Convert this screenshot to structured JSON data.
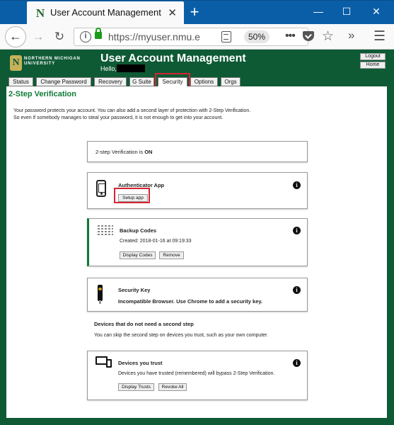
{
  "browser": {
    "tab_title": "User Account Management",
    "url": "https://myuser.nmu.e",
    "zoom": "50%",
    "colors": {
      "titlebar": "#0a5ea8",
      "toolbar": "#f9f9fa"
    }
  },
  "header": {
    "logo_text_line1": "NORTHERN MICHIGAN",
    "logo_text_line2": "UNIVERSITY",
    "title": "User Account Management",
    "hello": "Hello,",
    "logout": "Logout",
    "home": "Home",
    "colors": {
      "brand_green": "#0e5a35",
      "gold": "#c6b25a"
    }
  },
  "tabs": [
    "Status",
    "Change Password",
    "Recovery",
    "G Suite",
    "Security",
    "Options",
    "Orgs"
  ],
  "active_tab": "Security",
  "section_title": "2-Step Verification",
  "intro_line1": "Your password protects your account. You can also add a second layer of protection with 2-Step Verification.",
  "intro_line2": "So even if somebody manages to steal your password, it is not enough to get into your account.",
  "status_card": {
    "prefix": "2-step Verification is ",
    "state": "ON"
  },
  "authenticator": {
    "title": "Authenticator App",
    "button": "Setup app"
  },
  "backup_codes": {
    "title": "Backup Codes",
    "created": "Created: 2018-01-16 at 09:19:33",
    "display_button": "Display Codes",
    "remove_button": "Remove"
  },
  "security_key": {
    "title": "Security Key",
    "message": "Incompatible Browser. Use Chrome to add a security key."
  },
  "devices_section": {
    "heading": "Devices that do not need a second step",
    "description": "You can skip the second step on devices you trust, such as your own computer."
  },
  "trusted_devices": {
    "title": "Devices you trust",
    "description": "Devices you have trusted (remembered) will bypass 2-Step Verification.",
    "display_button": "Display Trusts",
    "revoke_button": "Revoke All"
  },
  "highlight_color": "#d72533"
}
